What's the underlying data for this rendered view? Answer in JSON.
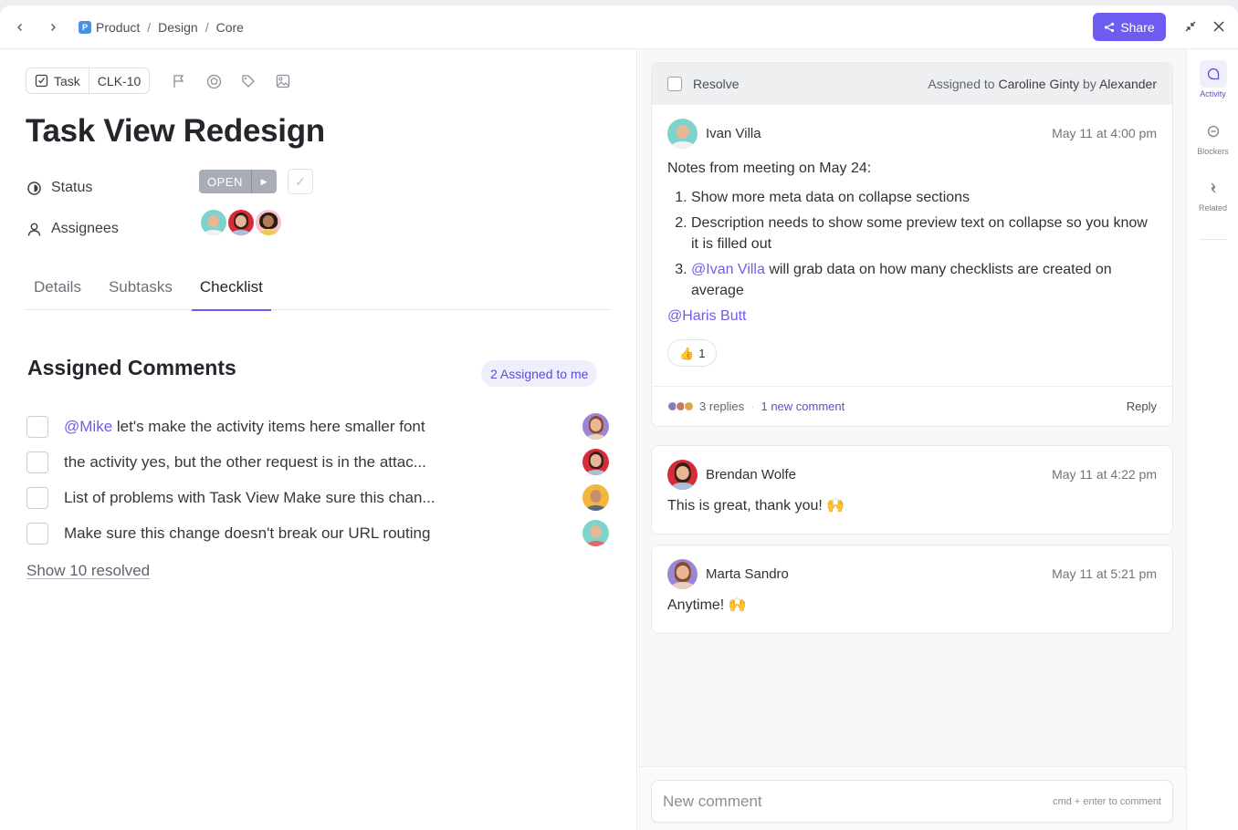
{
  "topbar": {
    "breadcrumb": [
      {
        "label": "Product",
        "badge": "P"
      },
      {
        "label": "Design"
      },
      {
        "label": "Core"
      }
    ],
    "share_label": "Share",
    "accent": "#6d5cf0"
  },
  "task": {
    "type_label": "Task",
    "id": "CLK-10",
    "title": "Task View Redesign",
    "status_label": "Status",
    "status_value": "OPEN",
    "assignees_label": "Assignees",
    "assignees": [
      "Ivan Villa",
      "Brendan Wolfe",
      "Marta Sandro"
    ]
  },
  "tabs": [
    {
      "label": "Details",
      "active": false
    },
    {
      "label": "Subtasks",
      "active": false
    },
    {
      "label": "Checklist",
      "active": true
    }
  ],
  "assigned_comments": {
    "title": "Assigned Comments",
    "badge": "2 Assigned to me",
    "items": [
      {
        "mention": "@Mike",
        "text": " let's make the activity items here smaller font"
      },
      {
        "mention": "",
        "text": "the activity yes, but the other request is in the attac..."
      },
      {
        "mention": "",
        "text": "List of problems with Task View Make sure this chan..."
      },
      {
        "mention": "",
        "text": "Make sure this change doesn't break our URL routing"
      }
    ],
    "show_resolved": "Show 10 resolved"
  },
  "thread": {
    "resolve_label": "Resolve",
    "assigned_prefix": "Assigned to ",
    "assigned_to": "Caroline Ginty",
    "assigned_by_prefix": " by ",
    "assigned_by": "Alexander",
    "main": {
      "author": "Ivan Villa",
      "time": "May 11 at 4:00 pm",
      "intro": "Notes from meeting on May 24:",
      "list": [
        {
          "mention": "",
          "text": "Show more meta data on collapse sections"
        },
        {
          "mention": "",
          "text": "Description needs to show some preview text on collapse so you know it is filled out"
        },
        {
          "mention": "@Ivan Villa",
          "text": " will grab data on how many checklists are created on average"
        }
      ],
      "footer_mention": "@Haris Butt",
      "reaction_emoji": "👍",
      "reaction_count": "1",
      "replies": "3 replies",
      "new_comment": "1 new comment",
      "reply_label": "Reply"
    },
    "replies": [
      {
        "author": "Brendan Wolfe",
        "time": "May 11 at 4:22 pm",
        "text": "This is great, thank you! 🙌"
      },
      {
        "author": "Marta Sandro",
        "time": "May 11 at 5:21 pm",
        "text": "Anytime! 🙌"
      }
    ]
  },
  "composer": {
    "placeholder": "New comment",
    "hint": "cmd + enter to comment"
  },
  "rail": [
    {
      "label": "Activity",
      "icon": "activity-icon",
      "active": true
    },
    {
      "label": "Blockers",
      "icon": "blockers-icon",
      "active": false
    },
    {
      "label": "Related",
      "icon": "related-icon",
      "active": false
    }
  ]
}
